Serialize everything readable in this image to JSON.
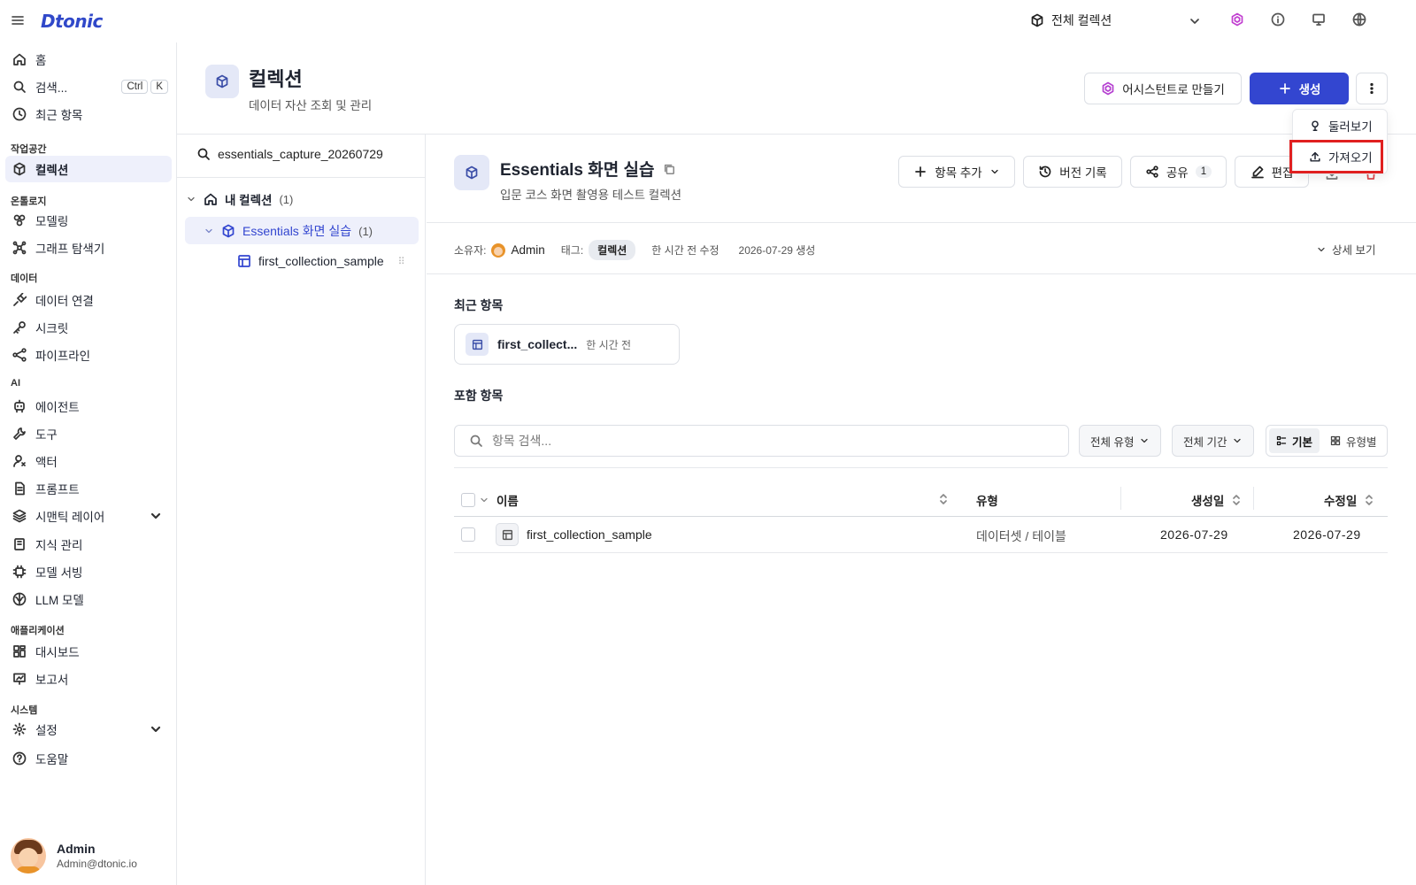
{
  "topbar": {
    "logo": "Dtonic",
    "scope": "전체 컬렉션"
  },
  "sidebar": {
    "home": "홈",
    "search": "검색...",
    "kbd_ctrl": "Ctrl",
    "kbd_k": "K",
    "recent": "최근 항목",
    "sec_workspace": "작업공간",
    "collections": "컬렉션",
    "sec_ontology": "온톨로지",
    "modeling": "모델링",
    "graph": "그래프 탐색기",
    "sec_data": "데이터",
    "data_conn": "데이터 연결",
    "secret": "시크릿",
    "pipeline": "파이프라인",
    "sec_ai": "AI",
    "agent": "에이전트",
    "tool": "도구",
    "actor": "액터",
    "prompt": "프롬프트",
    "semantic": "시맨틱 레이어",
    "knowledge": "지식 관리",
    "serving": "모델 서빙",
    "llm": "LLM 모델",
    "sec_app": "애플리케이션",
    "dashboard": "대시보드",
    "report": "보고서",
    "sec_system": "시스템",
    "settings": "설정",
    "help": "도움말"
  },
  "user": {
    "name": "Admin",
    "email": "Admin@dtonic.io"
  },
  "page": {
    "title": "컬렉션",
    "subtitle": "데이터 자산 조회 및 관리",
    "assistant_btn": "어시스턴트로 만들기",
    "create_btn": "생성"
  },
  "menu": {
    "tour": "둘러보기",
    "import": "가져오기"
  },
  "tree": {
    "search": "essentials_capture_20260729",
    "my": "내 컬렉션",
    "my_count": "(1)",
    "coll": "Essentials 화면 실습",
    "coll_count": "(1)",
    "item": "first_collection_sample"
  },
  "detail": {
    "title": "Essentials 화면 실습",
    "subtitle": "입문 코스 화면 촬영용 테스트 컬렉션",
    "add_btn": "항목 추가",
    "version_btn": "버전 기록",
    "share_btn": "공유",
    "share_count": "1",
    "edit_btn": "편집",
    "owner_label": "소유자:",
    "owner": "Admin",
    "tag_label": "태그:",
    "tag": "컬렉션",
    "modified": "한 시간 전 수정",
    "created": "2026-07-29 생성",
    "more": "상세 보기",
    "recent_title": "최근 항목",
    "recent_name": "first_collect...",
    "recent_time": "한 시간 전",
    "included_title": "포함 항목",
    "search_placeholder": "항목 검색...",
    "filter_type": "전체 유형",
    "filter_period": "전체 기간",
    "view_basic": "기본",
    "view_type": "유형별"
  },
  "table": {
    "headers": {
      "name": "이름",
      "type": "유형",
      "created": "생성일",
      "modified": "수정일"
    },
    "rows": [
      {
        "name": "first_collection_sample",
        "type": "데이터셋 / 테이블",
        "created": "2026-07-29",
        "modified": "2026-07-29"
      }
    ]
  }
}
